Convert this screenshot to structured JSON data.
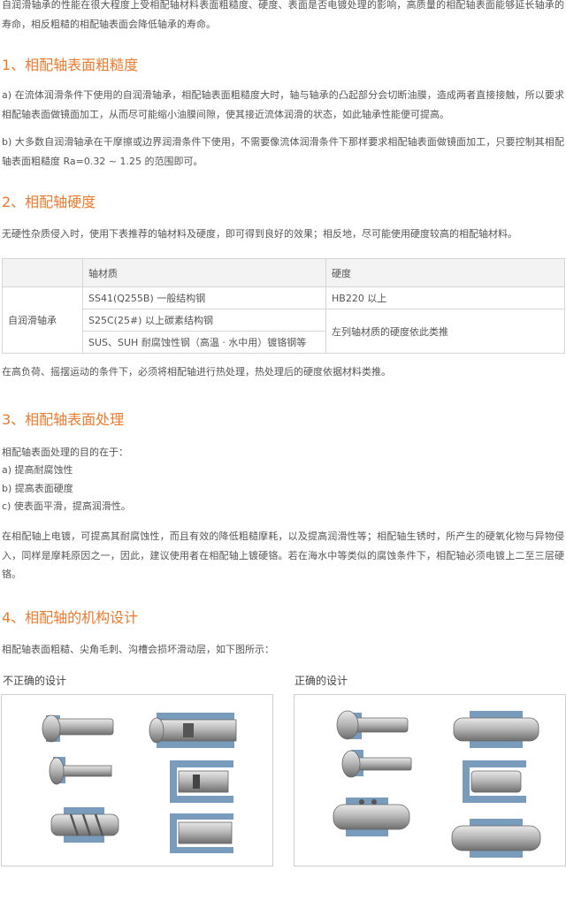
{
  "intro": "自润滑轴承的性能在很大程度上受相配轴材料表面粗糙度、硬度、表面是否电镀处理的影响，高质量的相配轴表面能够延长轴承的寿命，相反粗糙的相配轴表面会降低轴承的寿命。",
  "sec1": {
    "title": "1、相配轴表面粗糙度",
    "para_a": "a) 在流体润滑条件下使用的自润滑轴承，相配轴表面粗糙度大时，轴与轴承的凸起部分会切断油膜，造成两者直接接触，所以要求相配轴表面做镜面加工，从而尽可能缩小油膜间隙，使其接近流体润滑的状态，如此轴承性能便可提高。",
    "para_b": "b) 大多数自润滑轴承在干摩擦或边界润滑条件下使用，不需要像流体润滑条件下那样要求相配轴表面做镜面加工，只要控制其相配轴表面粗糙度 Ra=0.32 ~ 1.25 的范围即可。"
  },
  "sec2": {
    "title": "2、相配轴硬度",
    "para": "无硬性杂质侵入时，使用下表推荐的轴材料及硬度，即可得到良好的效果；相反地，尽可能使用硬度较高的相配轴材料。",
    "table": {
      "header": [
        "",
        "轴材质",
        "硬度"
      ],
      "row_label": "自润滑轴承",
      "materials": [
        "SS41(Q255B) 一般结构钢",
        "S25C(25#) 以上碳素结构钢",
        "SUS、SUH 耐腐蚀性钢（高温 · 水中用）镀铬钢等"
      ],
      "hardness_1": "HB220 以上",
      "hardness_2": "左列轴材质的硬度依此类推"
    },
    "after": "在高负荷、摇摆运动的条件下，必须将相配轴进行热处理，热处理后的硬度依据材料类推。"
  },
  "sec3": {
    "title": "3、相配轴表面处理",
    "lead": "相配轴表面处理的目的在于：",
    "items": [
      "a) 提高耐腐蚀性",
      "b) 提高表面硬度",
      "c) 使表面平滑，提高润滑性。"
    ],
    "para": "在相配轴上电镀，可提高其耐腐蚀性，而且有效的降低粗糙摩耗，以及提高润滑性等；相配轴生锈时，所产生的硬氧化物与异物侵入，同样是摩耗原因之一，因此，建议使用者在相配轴上镀硬铬。若在海水中等类似的腐蚀条件下，相配轴必须电镀上二至三层硬铬。"
  },
  "sec4": {
    "title": "4、相配轴的机构设计",
    "para": "相配轴表面粗糙、尖角毛刺、沟槽会损坏滑动层，如下图所示：",
    "wrong_caption": "不正确的设计",
    "right_caption": "正确的设计"
  },
  "colors": {
    "heading": "#ee7a2e",
    "text": "#555555",
    "bearing": "#7a9cbc",
    "shaft": "#9a9a9a"
  }
}
